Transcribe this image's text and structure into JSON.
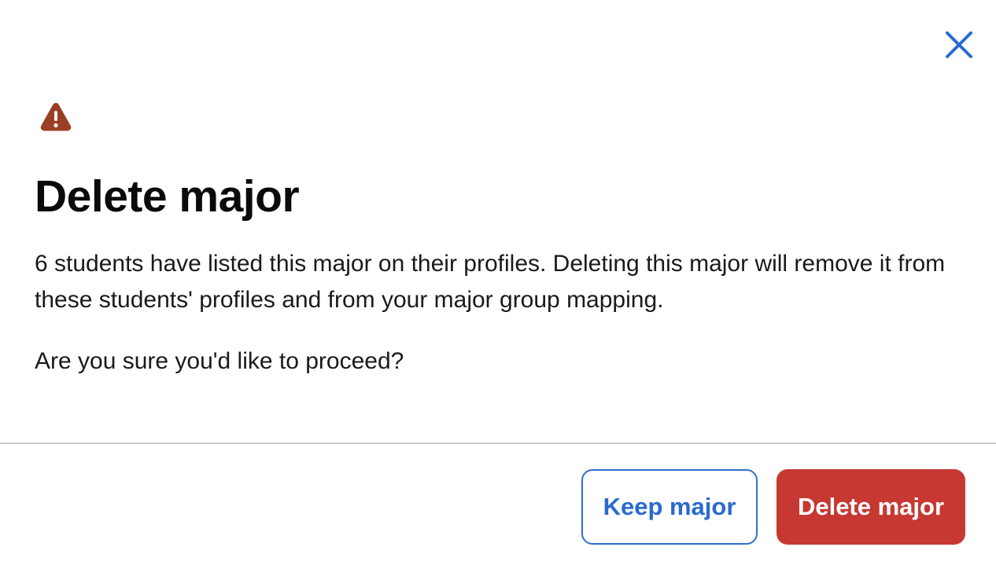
{
  "dialog": {
    "title": "Delete major",
    "body": "6 students have listed this major on their profiles. Deleting this major will remove it from these students' profiles and from your major group mapping.",
    "question": "Are you sure you'd like to proceed?",
    "icons": {
      "close": "close-icon",
      "warning": "warning-icon"
    },
    "colors": {
      "accent": "#2a6ad0",
      "danger": "#c73833",
      "warning": "#9a3f24"
    }
  },
  "footer": {
    "keep_label": "Keep major",
    "delete_label": "Delete major"
  }
}
